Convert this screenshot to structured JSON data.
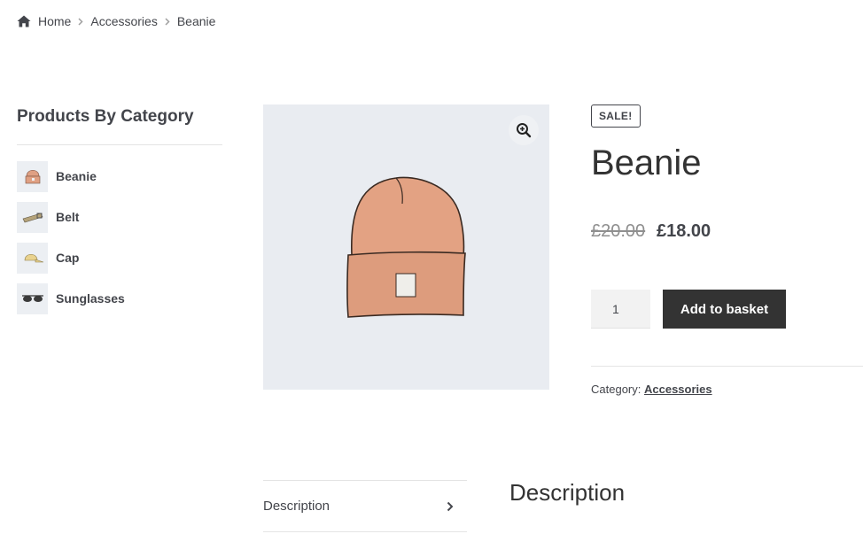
{
  "breadcrumb": {
    "items": [
      "Home",
      "Accessories",
      "Beanie"
    ],
    "home_icon": "home-icon",
    "separator_icon": "chevron-right-icon"
  },
  "sidebar": {
    "title": "Products By Category",
    "items": [
      {
        "label": "Beanie",
        "icon": "beanie-thumbnail"
      },
      {
        "label": "Belt",
        "icon": "belt-thumbnail"
      },
      {
        "label": "Cap",
        "icon": "cap-thumbnail"
      },
      {
        "label": "Sunglasses",
        "icon": "sunglasses-thumbnail"
      }
    ]
  },
  "gallery": {
    "image": "beanie-illustration",
    "zoom_icon": "zoom-in-icon"
  },
  "product": {
    "sale_badge": "SALE!",
    "title": "Beanie",
    "price_old": "£20.00",
    "price_new": "£18.00",
    "quantity": "1",
    "add_to_basket": "Add to basket",
    "category_label": "Category:",
    "category_value": "Accessories"
  },
  "tabs": {
    "items": [
      {
        "label": "Description",
        "icon": "chevron-right-icon"
      }
    ],
    "active_heading": "Description"
  },
  "colors": {
    "text": "#43454b",
    "button_bg": "#333333",
    "button_text": "#ffffff",
    "image_bg": "#e9ecf1",
    "beanie": "#e0a080"
  }
}
